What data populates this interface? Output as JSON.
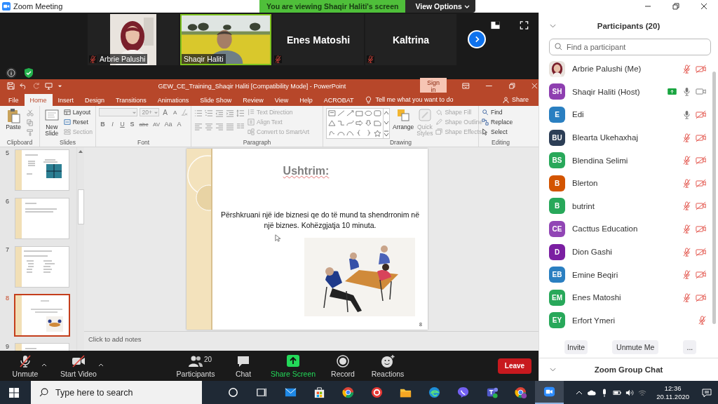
{
  "window": {
    "title": "Zoom Meeting"
  },
  "share_banner": {
    "text": "You are viewing Shaqir Haliti's screen",
    "view_options": "View Options"
  },
  "video_tiles": [
    {
      "name": "Arbrie Palushi",
      "kind": "picture",
      "muted": true,
      "active": false
    },
    {
      "name": "Shaqir Haliti",
      "kind": "picture",
      "muted": false,
      "active": true
    },
    {
      "name": "Enes Matoshi",
      "kind": "name",
      "muted": true,
      "active": false
    },
    {
      "name": "Kaltrina",
      "kind": "name",
      "muted": true,
      "active": false
    }
  ],
  "powerpoint": {
    "title": "GEW_CE_Training_Shaqir Haliti [Compatibility Mode] - PowerPoint",
    "sign_in": "Sign in",
    "tabs": [
      {
        "label": "File",
        "selected": false
      },
      {
        "label": "Home",
        "selected": true
      },
      {
        "label": "Insert",
        "selected": false
      },
      {
        "label": "Design",
        "selected": false
      },
      {
        "label": "Transitions",
        "selected": false
      },
      {
        "label": "Animations",
        "selected": false
      },
      {
        "label": "Slide Show",
        "selected": false
      },
      {
        "label": "Review",
        "selected": false
      },
      {
        "label": "View",
        "selected": false
      },
      {
        "label": "Help",
        "selected": false
      },
      {
        "label": "ACROBAT",
        "selected": false
      }
    ],
    "tell_me": "Tell me what you want to do",
    "share": "Share",
    "ribbon": {
      "clipboard": {
        "label": "Clipboard",
        "paste": "Paste"
      },
      "slides": {
        "label": "Slides",
        "new_slide": "New Slide",
        "commands": [
          {
            "label": "Layout",
            "disabled": false
          },
          {
            "label": "Reset",
            "disabled": false
          },
          {
            "label": "Section",
            "disabled": true
          }
        ]
      },
      "font": {
        "label": "Font",
        "size": "20+",
        "size_buttons": [
          "A",
          "A"
        ],
        "buttons": [
          "B",
          "I",
          "U",
          "S",
          "abc",
          "AV",
          "Aa",
          "A"
        ]
      },
      "paragraph": {
        "label": "Paragraph",
        "commands": [
          {
            "label": "Text Direction",
            "disabled": true
          },
          {
            "label": "Align Text",
            "disabled": true
          },
          {
            "label": "Convert to SmartArt",
            "disabled": true
          }
        ]
      },
      "drawing": {
        "label": "Drawing",
        "commands": [
          {
            "label": "Arrange",
            "disabled": false
          },
          {
            "label": "Quick Styles",
            "disabled": true
          }
        ],
        "shape_commands": [
          {
            "label": "Shape Fill",
            "disabled": true
          },
          {
            "label": "Shape Outline",
            "disabled": true
          },
          {
            "label": "Shape Effects",
            "disabled": true
          }
        ]
      },
      "editing": {
        "label": "Editing",
        "commands": [
          {
            "label": "Find",
            "disabled": false
          },
          {
            "label": "Replace",
            "disabled": false
          },
          {
            "label": "Select",
            "disabled": false
          }
        ]
      }
    },
    "thumbnails": [
      {
        "number": "5",
        "kind": "matrix",
        "selected": false
      },
      {
        "number": "6",
        "kind": "text",
        "selected": false
      },
      {
        "number": "7",
        "kind": "bullets",
        "selected": false
      },
      {
        "number": "8",
        "selected": true
      },
      {
        "number": "9",
        "kind": "text",
        "selected": false
      }
    ],
    "slide": {
      "title": "Ushtrim:",
      "body": "Përshkruani një ide biznesi qe do të mund ta shendrronim në një biznes. Kohëzgjatja 10 minuta.",
      "number": "8"
    },
    "notes_placeholder": "Click to add notes"
  },
  "meeting_controls": [
    {
      "label": "Unmute",
      "kind": "mic",
      "off": true
    },
    {
      "label": "Start Video",
      "kind": "video",
      "off": true
    },
    {
      "label": "Participants",
      "kind": "participants",
      "count": "20"
    },
    {
      "label": "Chat",
      "kind": "chat"
    },
    {
      "label": "Share Screen",
      "kind": "share"
    },
    {
      "label": "Record",
      "kind": "record"
    },
    {
      "label": "Reactions",
      "kind": "reactions"
    }
  ],
  "leave": "Leave",
  "participants_panel": {
    "title": "Participants (20)",
    "search_placeholder": "Find a participant",
    "people": [
      {
        "name": "Arbrie Palushi (Me)",
        "mic_muted": true,
        "video_off": true
      },
      {
        "name": "Shaqir Haliti (Host)",
        "kind": "initials",
        "initials": "SH",
        "color": "#8e3fb0",
        "sharing": true,
        "mic_muted": false,
        "video_off": false
      },
      {
        "name": "Edi",
        "kind": "initials",
        "initials": "E",
        "color": "#2a7fc1",
        "mic_muted": false,
        "video_off": true
      },
      {
        "name": "Blearta Ukehaxhaj",
        "kind": "initials",
        "initials": "BU",
        "color": "#2c3e56",
        "mic_muted": true,
        "video_off": true
      },
      {
        "name": "Blendina Selimi",
        "kind": "initials",
        "initials": "BS",
        "color": "#28a85a",
        "mic_muted": true,
        "video_off": true
      },
      {
        "name": "Blerton",
        "kind": "initials",
        "initials": "B",
        "color": "#d35400",
        "mic_muted": true,
        "video_off": true
      },
      {
        "name": "butrint",
        "kind": "initials",
        "initials": "B",
        "color": "#28a85a",
        "mic_muted": true,
        "video_off": true
      },
      {
        "name": "Cacttus Education",
        "kind": "initials",
        "initials": "CE",
        "color": "#9146b5",
        "mic_muted": true,
        "video_off": true
      },
      {
        "name": "Dion Gashi",
        "kind": "initials",
        "initials": "D",
        "color": "#7b1fa2",
        "mic_muted": true,
        "video_off": true
      },
      {
        "name": "Emine Beqiri",
        "kind": "initials",
        "initials": "EB",
        "color": "#2a7fc1",
        "mic_muted": true,
        "video_off": true
      },
      {
        "name": "Enes Matoshi",
        "kind": "initials",
        "initials": "EM",
        "color": "#28a85a",
        "mic_muted": true,
        "video_off": true
      },
      {
        "name": "Erfort Ymeri",
        "kind": "initials",
        "initials": "EY",
        "color": "#28a85a",
        "mic_muted": true
      }
    ],
    "buttons": [
      "Invite",
      "Unmute Me",
      "..."
    ],
    "chat_title": "Zoom Group Chat"
  },
  "taskbar": {
    "search_placeholder": "Type here to search",
    "apps": [
      {
        "active": false
      },
      {
        "active": false
      },
      {
        "active": false
      },
      {
        "active": false
      },
      {
        "active": false
      },
      {
        "active": false
      },
      {
        "active": false
      },
      {
        "active": false
      },
      {
        "active": false
      },
      {
        "active": false
      },
      {
        "active": false
      },
      {
        "active": true
      }
    ],
    "time": "12:36",
    "date": "20.11.2020"
  }
}
